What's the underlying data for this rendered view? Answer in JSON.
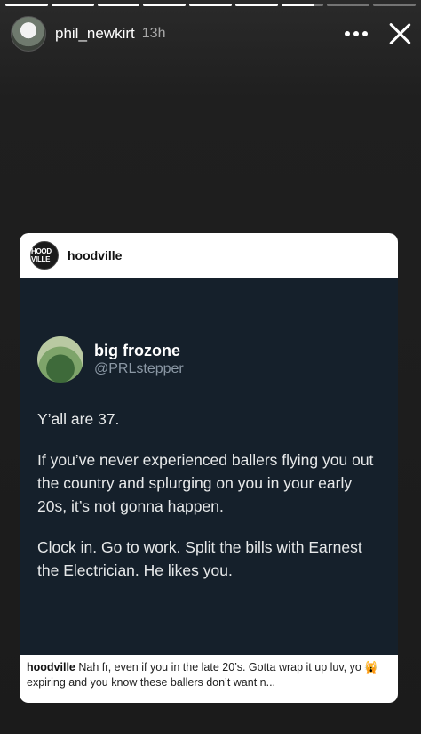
{
  "story": {
    "progress": [
      1,
      1,
      1,
      1,
      1,
      1,
      0.75,
      0,
      0
    ],
    "username": "phil_newkirt",
    "time": "13h"
  },
  "post": {
    "account": "hoodville",
    "avatar_text": "HOOD VILLE",
    "tweet": {
      "name": "big frozone",
      "handle": "@PRLstepper",
      "paragraphs": [
        "Y’all are 37.",
        "If you’ve never experienced ballers flying you out the country and splurging on you in your early 20s, it’s not gonna happen.",
        "Clock in. Go to work. Split the bills with Earnest the Electrician. He likes you."
      ]
    },
    "caption": {
      "user": "hoodville",
      "text": "Nah fr, even if you in the late 20’s. Gotta wrap it up luv, yo 🙀 expiring and you know these ballers don’t want n..."
    }
  }
}
